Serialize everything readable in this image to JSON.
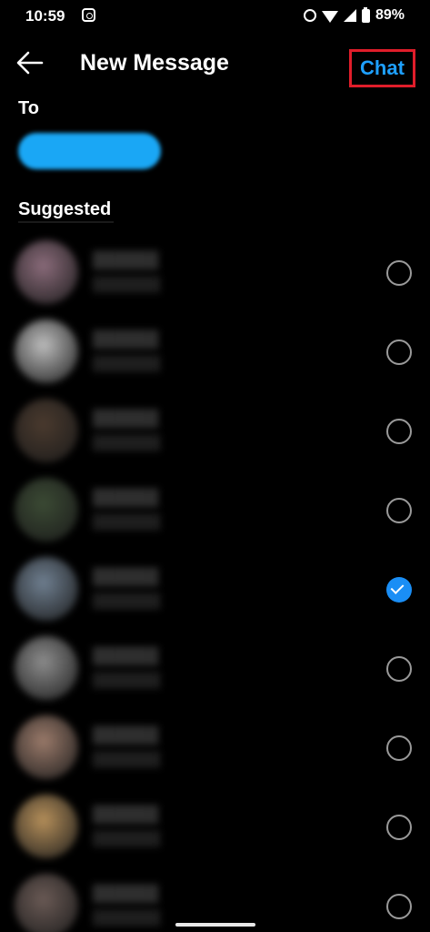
{
  "status_bar": {
    "time": "10:59",
    "battery": "89%"
  },
  "header": {
    "title": "New Message",
    "chat_button": "Chat"
  },
  "recipients": {
    "label": "To"
  },
  "suggested": {
    "label": "Suggested"
  },
  "contacts": [
    {
      "selected": false,
      "avatar_color": "#8a6b7a"
    },
    {
      "selected": false,
      "avatar_color": "#bdbdbd"
    },
    {
      "selected": false,
      "avatar_color": "#4a3a2e"
    },
    {
      "selected": false,
      "avatar_color": "#3b4a34"
    },
    {
      "selected": true,
      "avatar_color": "#6f7f90"
    },
    {
      "selected": false,
      "avatar_color": "#8c8c8c"
    },
    {
      "selected": false,
      "avatar_color": "#9a7a6a"
    },
    {
      "selected": false,
      "avatar_color": "#b58f5a"
    },
    {
      "selected": false,
      "avatar_color": "#6a5a55"
    }
  ],
  "colors": {
    "accent": "#1a8ef5",
    "chat_text": "#1ea0ff",
    "highlight_border": "#e01d2a",
    "background": "#000000"
  }
}
